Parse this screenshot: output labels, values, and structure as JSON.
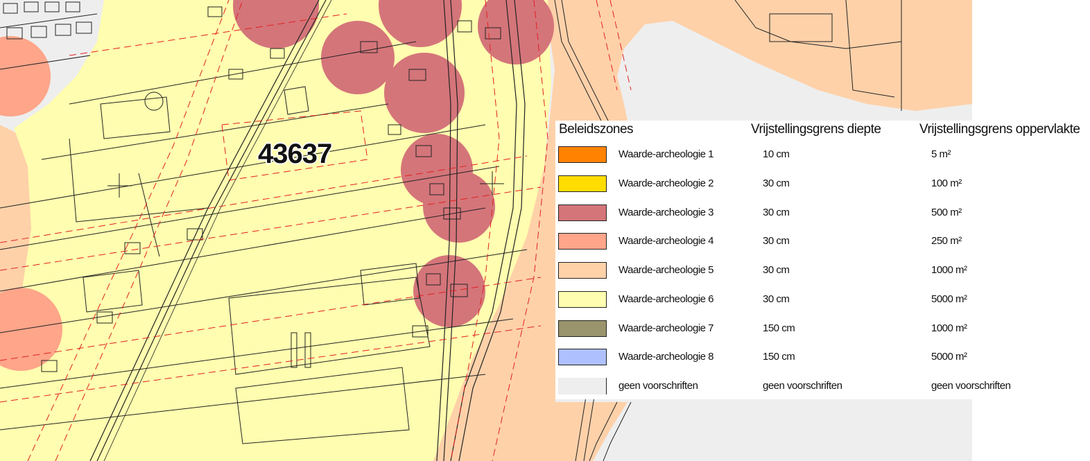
{
  "map": {
    "parcel_label": "43637"
  },
  "legend": {
    "headers": {
      "zone": "Beleidszones",
      "depth": "Vrijstellingsgrens diepte",
      "area": "Vrijstellingsgrens oppervlakte"
    },
    "rows": [
      {
        "label": "Waarde-archeologie 1",
        "depth": "10 cm",
        "area": "5 m²",
        "color": "#ff8200"
      },
      {
        "label": "Waarde-archeologie 2",
        "depth": "30 cm",
        "area": "100 m²",
        "color": "#ffdd00"
      },
      {
        "label": "Waarde-archeologie 3",
        "depth": "30 cm",
        "area": "500 m²",
        "color": "#d4757a"
      },
      {
        "label": "Waarde-archeologie 4",
        "depth": "30 cm",
        "area": "250 m²",
        "color": "#fea58a"
      },
      {
        "label": "Waarde-archeologie 5",
        "depth": "30 cm",
        "area": "1000 m²",
        "color": "#fed1a9"
      },
      {
        "label": "Waarde-archeologie 6",
        "depth": "30 cm",
        "area": "5000 m²",
        "color": "#fffdaf"
      },
      {
        "label": "Waarde-archeologie 7",
        "depth": "150 cm",
        "area": "1000 m²",
        "color": "#99946b"
      },
      {
        "label": "Waarde-archeologie 8",
        "depth": "150 cm",
        "area": "5000 m²",
        "color": "#afc0ff"
      },
      {
        "label": "geen voorschriften",
        "depth": "geen voorschriften",
        "area": "geen voorschriften",
        "color": "#eeeeee"
      }
    ]
  }
}
